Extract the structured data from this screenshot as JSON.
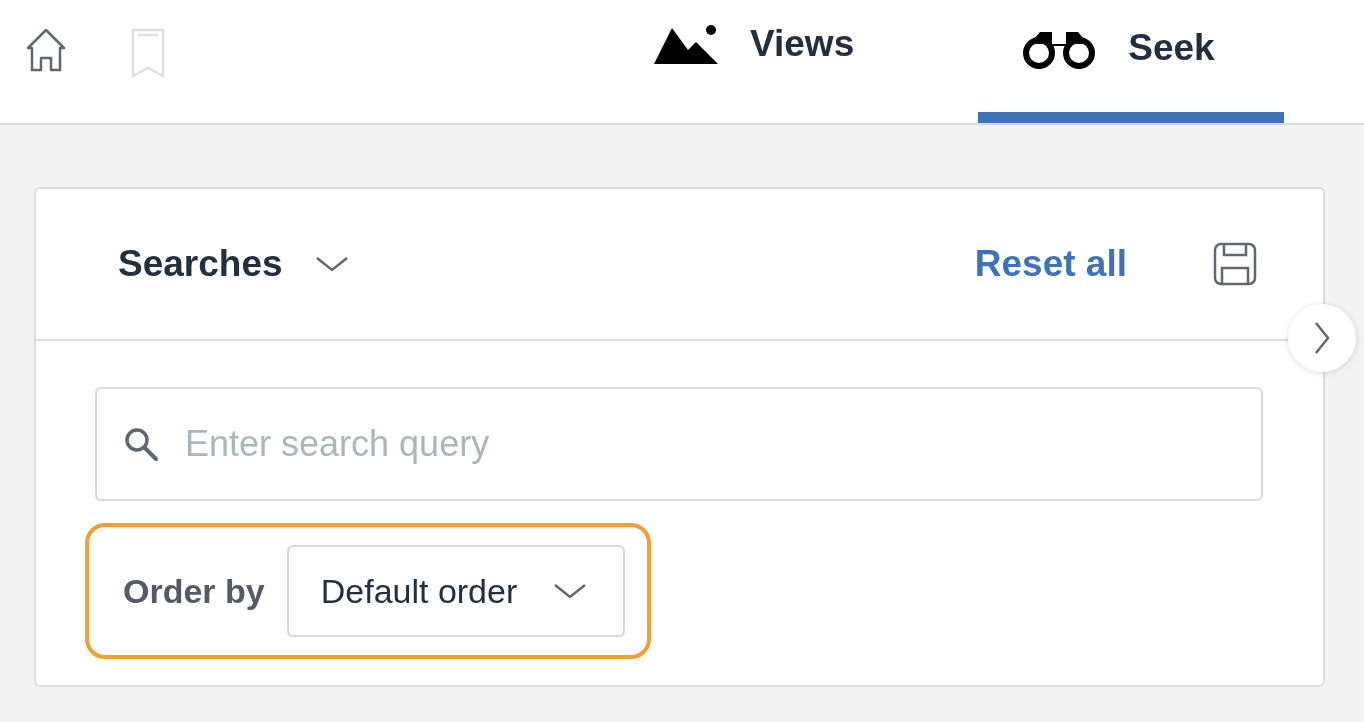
{
  "nav": {
    "bookmark": {
      "disabled": true
    }
  },
  "tabs": [
    {
      "label": "Views",
      "selected": false
    },
    {
      "label": "Seek",
      "selected": true
    }
  ],
  "panel": {
    "title": "Searches",
    "reset": "Reset all",
    "search": {
      "placeholder": "Enter search query"
    },
    "order": {
      "label": "Order by",
      "value": "Default order",
      "highlighted": true
    }
  }
}
